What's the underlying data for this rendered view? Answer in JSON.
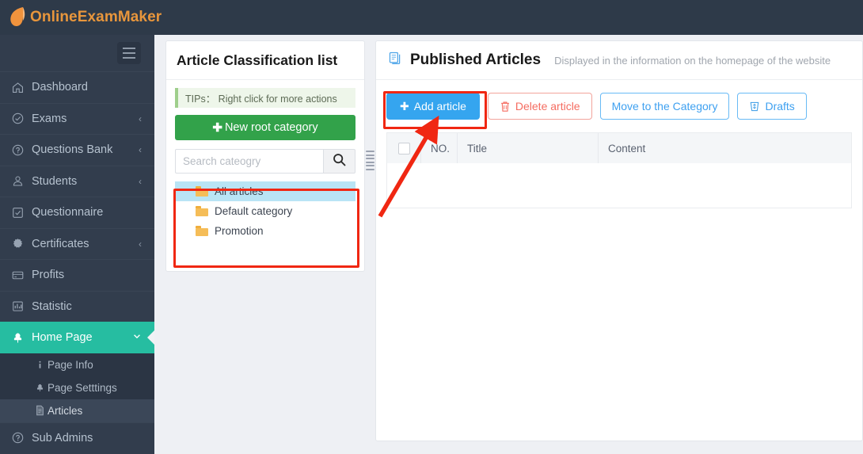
{
  "brand": {
    "name": "OnlineExamMaker",
    "color": "#e8963c",
    "topbar_color": "#2e3a49"
  },
  "sidebar": {
    "toggle_name": "menu-toggle",
    "items": [
      {
        "label": "Dashboard",
        "icon": "home-icon",
        "caret": "",
        "active": false
      },
      {
        "label": "Exams",
        "icon": "check-circle-icon",
        "caret": "‹",
        "active": false
      },
      {
        "label": "Questions Bank",
        "icon": "question-circle-icon",
        "caret": "‹",
        "active": false
      },
      {
        "label": "Students",
        "icon": "users-icon",
        "caret": "‹",
        "active": false
      },
      {
        "label": "Questionnaire",
        "icon": "checkbox-icon",
        "caret": "",
        "active": false
      },
      {
        "label": "Certificates",
        "icon": "badge-icon",
        "caret": "‹",
        "active": false
      },
      {
        "label": "Profits",
        "icon": "card-icon",
        "caret": "",
        "active": false
      },
      {
        "label": "Statistic",
        "icon": "bar-chart-icon",
        "caret": "",
        "active": false
      },
      {
        "label": "Home Page",
        "icon": "leaf-icon",
        "caret": "∨",
        "active": true
      }
    ],
    "subitems": [
      {
        "label": "Page Info",
        "icon": "info-icon",
        "selected": false
      },
      {
        "label": "Page Setttings",
        "icon": "leaf-small-icon",
        "selected": false
      },
      {
        "label": "Articles",
        "icon": "file-icon",
        "selected": true
      }
    ],
    "after_items": [
      {
        "label": "Sub Admins",
        "icon": "question-circle-icon",
        "caret": "",
        "active": false
      }
    ],
    "active_color": "#26bda1"
  },
  "classification": {
    "title": "Article Classification list",
    "tips": "TIPs： Right click for more actions",
    "new_root_label": "New root category",
    "new_root_color": "#32a24a",
    "search_placeholder": "Search cateogry",
    "search_value": "",
    "categories": [
      {
        "label": "All articles",
        "selected": true
      },
      {
        "label": "Default category",
        "selected": false
      },
      {
        "label": "Promotion",
        "selected": false
      }
    ]
  },
  "published": {
    "title": "Published Articles",
    "subtitle": "Displayed in the information on the homepage of the website",
    "buttons": [
      {
        "label": "Add article",
        "icon": "plus-icon",
        "style": "primary"
      },
      {
        "label": "Delete article",
        "icon": "trash-icon",
        "style": "danger"
      },
      {
        "label": "Move to the Category",
        "icon": "",
        "style": "default"
      },
      {
        "label": "Drafts",
        "icon": "drafts-icon",
        "style": "default"
      }
    ],
    "table": {
      "columns": [
        "",
        "NO.",
        "Title",
        "Content"
      ],
      "rows": []
    }
  },
  "annotations": {
    "highlight_color": "#f02712",
    "arrow_from": "table-area",
    "arrow_to": "add-article-button"
  }
}
